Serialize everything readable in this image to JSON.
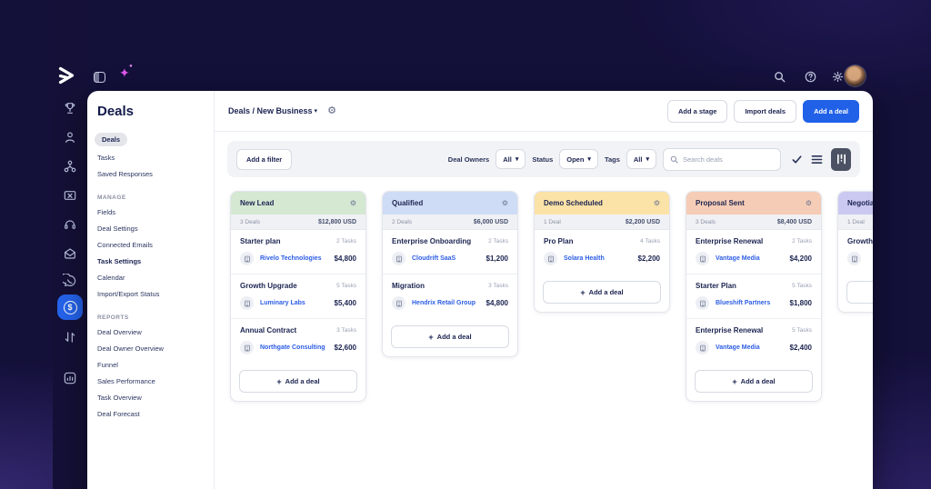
{
  "topbar": {
    "logo_icon": "arrow-logo",
    "left_icons": [
      "panel-toggle-icon",
      "sparkle-icon"
    ],
    "right_icons": [
      "search-icon",
      "help-icon",
      "settings-icon",
      "avatar"
    ]
  },
  "rail": {
    "icons": [
      "trophy-icon",
      "contacts-icon",
      "org-chart-icon",
      "campaign-icon",
      "headset-icon",
      "inbox-icon",
      "chat-icon",
      "deals-icon",
      "swap-icon",
      "analytics-icon"
    ],
    "active_icon": "deals-icon",
    "active_color": "#2563eb"
  },
  "sidebar": {
    "title": "Deals",
    "items": [
      "Deals",
      "Tasks",
      "Saved Responses"
    ],
    "active_item": "Deals",
    "sections": [
      {
        "label": "MANAGE",
        "items": [
          "Fields",
          "Deal Settings",
          "Connected Emails",
          "Task Settings",
          "Calendar",
          "Import/Export Status"
        ],
        "emphasized_item": "Task Settings"
      },
      {
        "label": "REPORTS",
        "items": [
          "Deal Overview",
          "Deal Owner Overview",
          "Funnel",
          "Sales Performance",
          "Task Overview",
          "Deal Forecast"
        ]
      }
    ]
  },
  "header": {
    "breadcrumb": "Deals / New Business",
    "buttons": [
      {
        "label": "Add a stage"
      },
      {
        "label": "Import deals"
      },
      {
        "label": "Add a deal",
        "primary": true,
        "color": "#2061e8"
      }
    ]
  },
  "filterbar": {
    "add_filter_label": "Add a filter",
    "deal_owners_label": "Deal Owners",
    "deal_owners_value": "All",
    "status_label": "Status",
    "status_value": "Open",
    "tags_label": "Tags",
    "tags_value": "All",
    "search_placeholder": "Search deals",
    "view_icons": [
      "check-icon",
      "list-view-icon",
      "kanban-view-icon"
    ],
    "active_view": "kanban-view-icon"
  },
  "board": {
    "add_deal_label": "Add a deal",
    "columns": [
      {
        "name": "New Lead",
        "color": "#d4e8d2",
        "deals": "3 Deals",
        "total": "$12,800 USD",
        "cards": [
          {
            "title": "Starter plan",
            "tasks": "2 Tasks",
            "company": "Rivelo Technologies",
            "amount": "$4,800"
          },
          {
            "title": "Growth Upgrade",
            "tasks": "5 Tasks",
            "company": "Luminary Labs",
            "amount": "$5,400"
          },
          {
            "title": "Annual Contract",
            "tasks": "3 Tasks",
            "company": "Northgate Consulting",
            "amount": "$2,600"
          }
        ]
      },
      {
        "name": "Qualified",
        "color": "#cfdcf5",
        "deals": "2 Deals",
        "total": "$6,000 USD",
        "cards": [
          {
            "title": "Enterprise Onboarding",
            "tasks": "2 Tasks",
            "company": "Cloudrift SaaS",
            "amount": "$1,200"
          },
          {
            "title": "Migration",
            "tasks": "3 Tasks",
            "company": "Hendrix Retail Group",
            "amount": "$4,800"
          }
        ]
      },
      {
        "name": "Demo Scheduled",
        "color": "#fbe2a6",
        "deals": "1 Deal",
        "total": "$2,200 USD",
        "cards": [
          {
            "title": "Pro Plan",
            "tasks": "4 Tasks",
            "company": "Solara Health",
            "amount": "$2,200"
          }
        ]
      },
      {
        "name": "Proposal Sent",
        "color": "#f5ccb5",
        "deals": "3 Deals",
        "total": "$8,400 USD",
        "cards": [
          {
            "title": "Enterprise Renewal",
            "tasks": "2 Tasks",
            "company": "Vantage Media",
            "amount": "$4,200"
          },
          {
            "title": "Starter Plan",
            "tasks": "5 Tasks",
            "company": "Blueshift Partners",
            "amount": "$1,800"
          },
          {
            "title": "Enterprise Renewal",
            "tasks": "5 Tasks",
            "company": "Vantage Media",
            "amount": "$2,400"
          }
        ]
      },
      {
        "name": "Negotiation",
        "color": "#cbc9f1",
        "deals": "1 Deal",
        "total": "",
        "cards": [
          {
            "title": "Growth Upgrade",
            "tasks": "",
            "company": "",
            "amount": ""
          }
        ]
      }
    ]
  }
}
